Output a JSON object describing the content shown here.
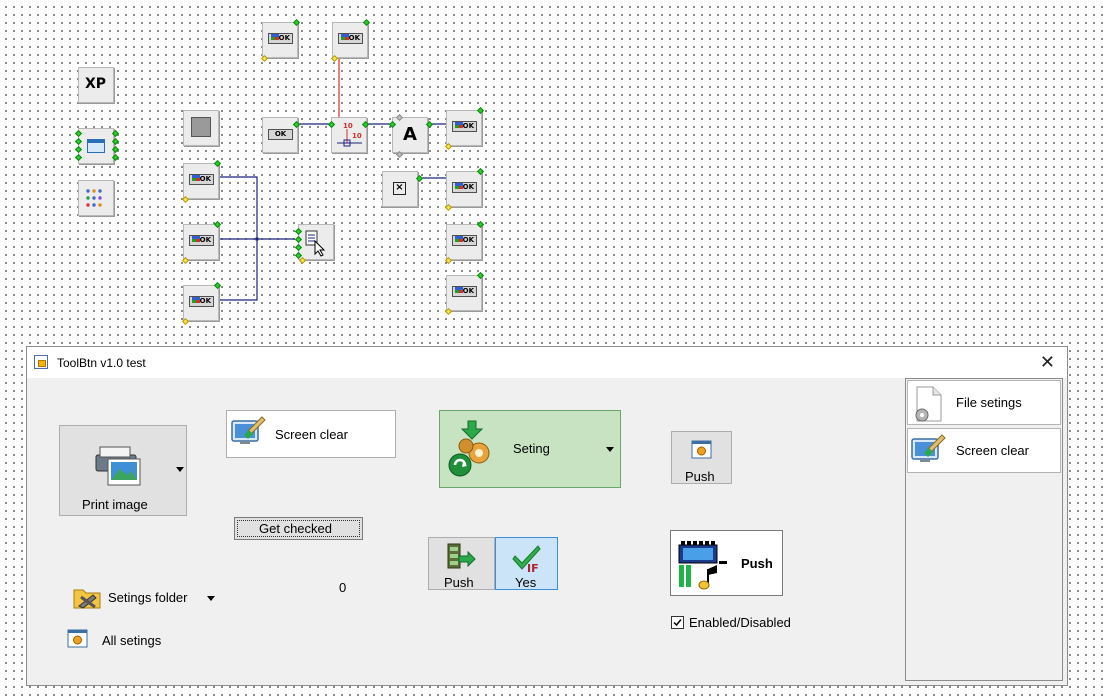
{
  "schematic": {
    "ok_label": "OK",
    "xp_label": "XP",
    "a_label": "A",
    "scale_label": "10"
  },
  "window": {
    "title": "ToolBtn v1.0 test",
    "close_glyph": "✕"
  },
  "buttons": {
    "print_image": "Print image",
    "screen_clear": "Screen clear",
    "seting": "Seting",
    "push_small": "Push",
    "get_checked": "Get checked",
    "push_left": "Push",
    "yes": "Yes",
    "push_big": "Push",
    "setings_folder": "Setings folder",
    "all_setings": "All setings"
  },
  "counter_value": "0",
  "checkbox": {
    "label": "Enabled/Disabled",
    "checked": true
  },
  "side_panel": {
    "items": [
      {
        "label": "File setings"
      },
      {
        "label": "Screen clear"
      }
    ]
  },
  "colors": {
    "wire_blue": "#1a237e",
    "wire_red": "#d32f2f",
    "pin_green": "#2ecc2e",
    "pin_yellow": "#f7e35a",
    "seting_bg": "#c7e3c2"
  },
  "icons": {
    "print": "printer-icon",
    "screen_clear": "monitor-brush-icon",
    "seting": "gears-refresh-icon",
    "push_small": "dialog-icon",
    "film": "film-strip-icon",
    "check": "check-if-icon",
    "folder": "folder-tools-icon",
    "file": "file-gear-icon"
  }
}
